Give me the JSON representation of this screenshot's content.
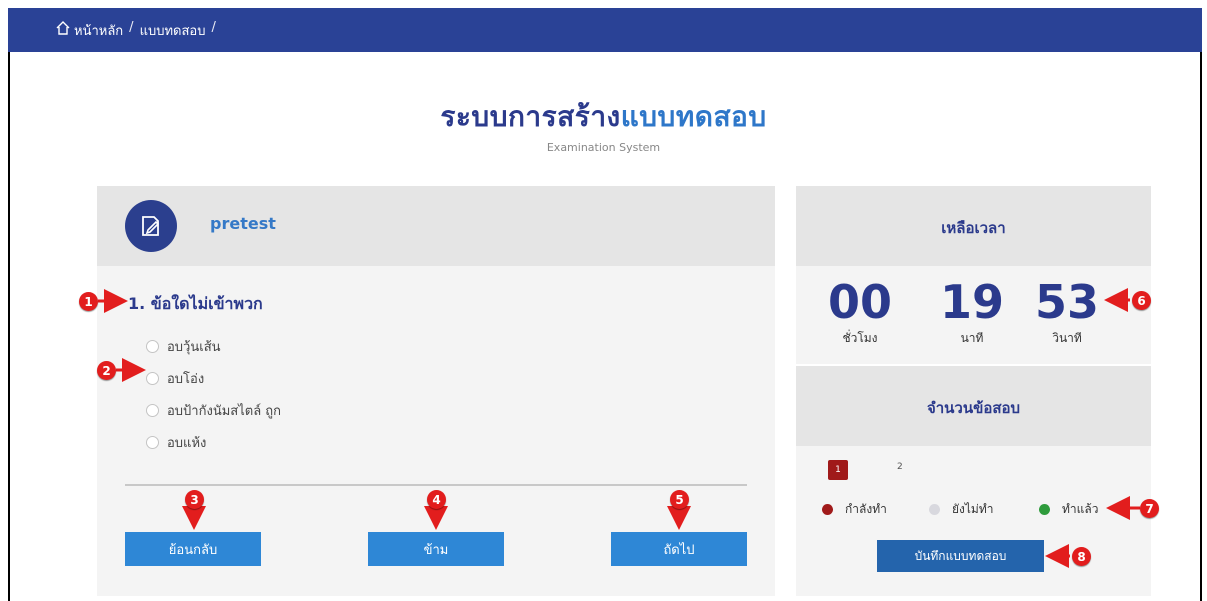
{
  "breadcrumb": {
    "home": "หน้าหลัก",
    "section": "แบบทดสอบ",
    "separator": "/"
  },
  "header": {
    "title_part1": "ระบบการสร้าง",
    "title_part2": "แบบทดสอบ",
    "subtitle": "Examination System"
  },
  "exam": {
    "name": "pretest"
  },
  "question": {
    "text": "1. ข้อใดไม่เข้าพวก",
    "options": [
      "อบวุ้นเส้น",
      "อบโอ่ง",
      "อบป้ากังนัมสไตล์ ถูก",
      "อบแห้ง"
    ]
  },
  "buttons": {
    "back": "ย้อนกลับ",
    "skip": "ข้าม",
    "next": "ถัดไป",
    "save": "บันทึกแบบทดสอบ"
  },
  "timer": {
    "title": "เหลือเวลา",
    "hours": "00",
    "minutes": "19",
    "seconds": "53",
    "hours_label": "ชั่วโมง",
    "minutes_label": "นาที",
    "seconds_label": "วินาที"
  },
  "questions_panel": {
    "title": "จำนวนข้อสอบ",
    "numbers": [
      "1",
      "2"
    ],
    "legend": [
      "กำลังทำ",
      "ยังไม่ทำ",
      "ทำแล้ว"
    ]
  },
  "markers": [
    "1",
    "2",
    "3",
    "4",
    "5",
    "6",
    "7",
    "8"
  ],
  "colors": {
    "topbar": "#2a4296",
    "primary_text": "#2b3a8c",
    "accent": "#2e77c9",
    "button": "#2e87d6",
    "save_button": "#2464ac",
    "in_progress": "#a01a1a",
    "not_done": "#d8d8de",
    "done": "#2e9b3c",
    "marker": "#e21d1d"
  },
  "icons": {
    "home": "home-icon",
    "exam": "edit-document-icon"
  }
}
